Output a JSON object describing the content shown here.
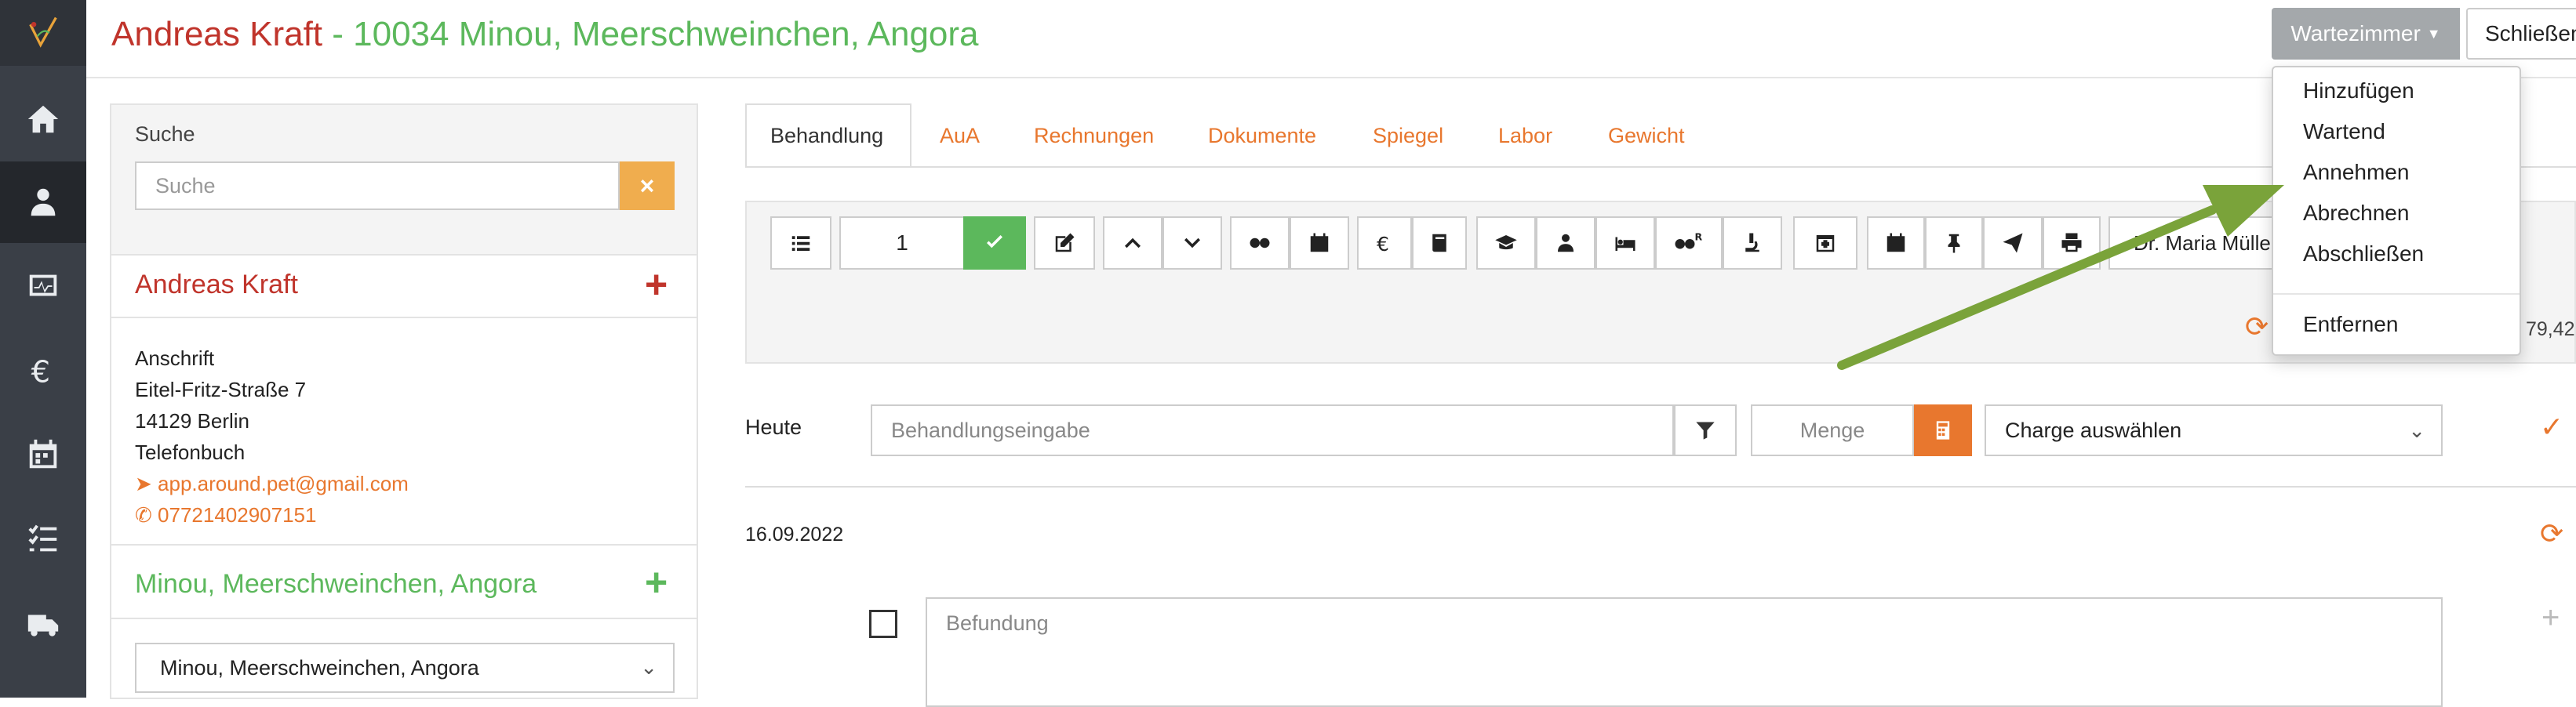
{
  "header": {
    "owner": "Andreas Kraft",
    "patient_line": " - 10034 Minou, Meerschweinchen, Angora",
    "waiting_room_button": "Wartezimmer",
    "close_button": "Schließen"
  },
  "waiting_menu": {
    "items": [
      "Hinzufügen",
      "Wartend",
      "Annehmen",
      "Abrechnen",
      "Abschließen"
    ],
    "remove": "Entfernen"
  },
  "sidebar_nav": [
    "home-icon",
    "patient-icon",
    "monitor-icon",
    "euro-icon",
    "calendar-icon",
    "checklist-icon",
    "truck-icon"
  ],
  "search": {
    "label": "Suche",
    "placeholder": "Suche",
    "clear": "×"
  },
  "owner_card": {
    "name": "Andreas Kraft",
    "add": "+",
    "address_label": "Anschrift",
    "street": "Eitel-Fritz-Straße 7",
    "city": "14129  Berlin",
    "phonebook": "Telefonbuch",
    "email": "app.around.pet@gmail.com",
    "phone": "07721402907151"
  },
  "patient_card": {
    "name": "Minou, Meerschweinchen, Angora",
    "add": "+",
    "selected": "Minou, Meerschweinchen, Angora"
  },
  "tabs": [
    "Behandlung",
    "AuA",
    "Rechnungen",
    "Dokumente",
    "Spiegel",
    "Labor",
    "Gewicht"
  ],
  "toolbar": {
    "quantity": "1",
    "vet": "Dr. Maria Müller",
    "amount": "79,42"
  },
  "entry": {
    "today_label": "Heute",
    "treatment_placeholder": "Behandlungseingabe",
    "quantity_placeholder": "Menge",
    "charge_select": "Charge auswählen"
  },
  "record": {
    "date": "16.09.2022",
    "finding_placeholder": "Befundung"
  },
  "colors": {
    "owner_red": "#c0342b",
    "patient_green": "#5cb85c",
    "accent_orange": "#e8772e",
    "arrow_green": "#7aa33a"
  }
}
